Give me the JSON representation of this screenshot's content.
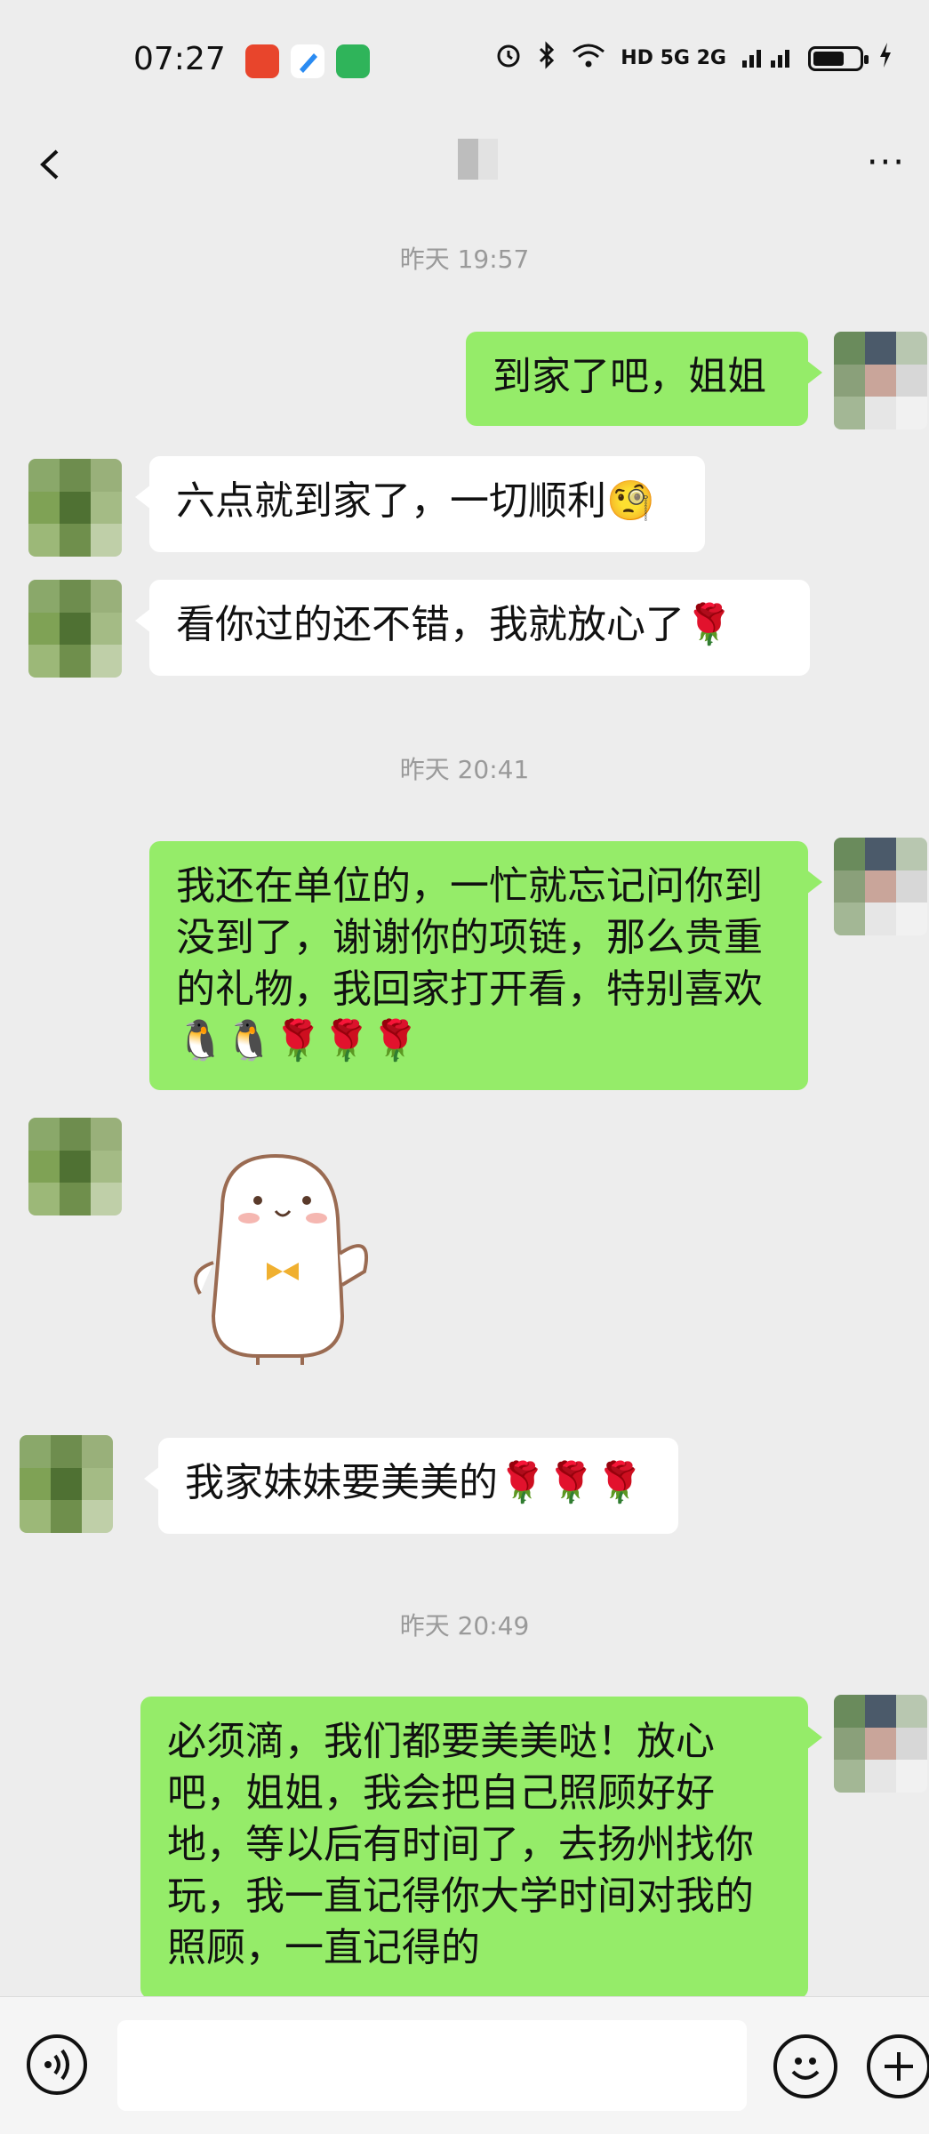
{
  "status_bar": {
    "time": "07:27",
    "network": "HD 5G 2G",
    "icons": [
      "alarm-icon",
      "bluetooth-icon",
      "wifi-icon",
      "signal-icon",
      "battery-icon",
      "charging-icon"
    ]
  },
  "nav": {
    "back_icon": "chevron-left-icon",
    "more_icon": "ellipsis-icon",
    "more_label": "···"
  },
  "chat": {
    "timestamps": [
      "昨天 19:57",
      "昨天 20:41",
      "昨天 20:49"
    ],
    "messages": [
      {
        "side": "out",
        "text": "到家了吧，姐姐"
      },
      {
        "side": "in",
        "text": "六点就到家了，一切顺利🧐"
      },
      {
        "side": "in",
        "text": "看你过的还不错，我就放心了🌹"
      },
      {
        "side": "out",
        "text": "我还在单位的，一忙就忘记问你到没到了，谢谢你的项链，那么贵重的礼物，我回家打开看，特别喜欢🐧🐧🌹🌹🌹"
      },
      {
        "side": "in",
        "type": "sticker",
        "sticker": "seal-sticker"
      },
      {
        "side": "in",
        "text": "我家妹妹要美美的🌹🌹🌹"
      },
      {
        "side": "out",
        "text": "必须滴，我们都要美美哒！放心吧，姐姐，我会把自己照顾好好地，等以后有时间了，去扬州找你玩，我一直记得你大学时间对我的照顾，一直记得的"
      }
    ]
  },
  "composer": {
    "voice_icon": "voice-icon",
    "input_value": "",
    "emoji_icon": "emoji-icon",
    "plus_icon": "plus-icon"
  },
  "colors": {
    "outgoing_bubble": "#95ec69",
    "incoming_bubble": "#ffffff",
    "background": "#ededed",
    "timestamp": "#9a9a9a"
  }
}
